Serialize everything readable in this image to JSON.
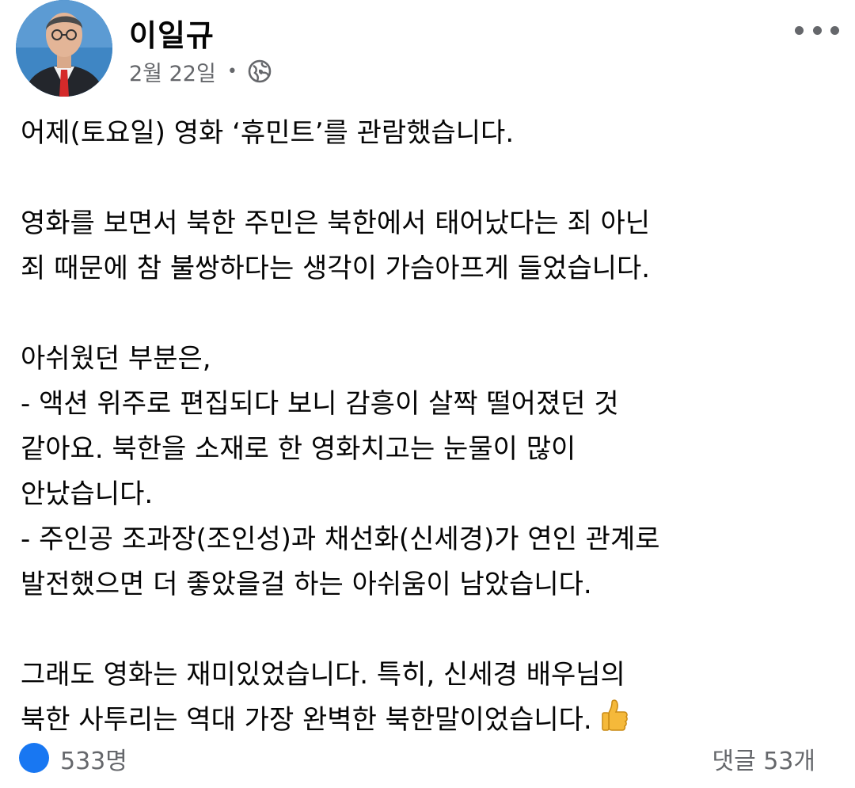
{
  "post": {
    "author": "이일규",
    "date": "2월 22일",
    "separator": "•",
    "privacy_icon": "globe-icon",
    "more_icon": "more-options-icon",
    "paragraphs": [
      [
        "어제(토요일) 영화 ‘휴민트’를 관람했습니다."
      ],
      [
        "영화를 보면서 북한 주민은 북한에서 태어났다는 죄 아닌",
        "죄 때문에 참 불쌍하다는 생각이 가슴아프게 들었습니다."
      ],
      [
        "아쉬웠던 부분은,",
        "- 액션 위주로 편집되다 보니 감흥이 살짝 떨어졌던 것",
        "같아요. 북한을 소재로 한 영화치고는 눈물이 많이",
        "안났습니다.",
        "- 주인공 조과장(조인성)과 채선화(신세경)가 연인 관계로",
        "발전했으면 더 좋았을걸 하는 아쉬움이 남았습니다."
      ],
      [
        "그래도 영화는 재미있었습니다.  특히, 신세경 배우님의",
        "북한 사투리는 역대 가장 완벽한 북한말이었습니다."
      ]
    ],
    "closing_emoji": "thumbs-up-icon"
  },
  "footer": {
    "reaction_icon": "like-icon",
    "reaction_count": "533명",
    "comment_count": "댓글 53개"
  },
  "colors": {
    "text": "#050505",
    "meta": "#65676b",
    "accent": "#1877f2"
  }
}
